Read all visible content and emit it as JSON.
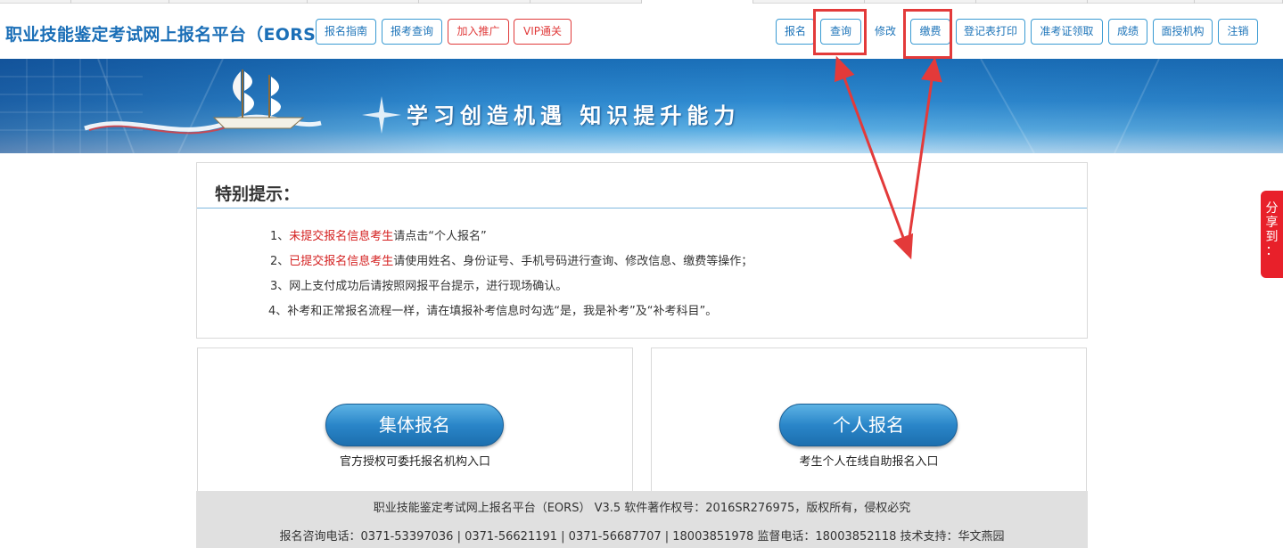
{
  "header": {
    "site_title": "职业技能鉴定考试网上报名平台（EORS）",
    "left_buttons": [
      {
        "label": "报名指南",
        "style": "blue"
      },
      {
        "label": "报考查询",
        "style": "blue"
      },
      {
        "label": "加入推广",
        "style": "red"
      },
      {
        "label": "VIP通关",
        "style": "red"
      }
    ],
    "right_buttons": [
      {
        "label": "报名"
      },
      {
        "label": "查询"
      },
      {
        "label": "修改"
      },
      {
        "label": "缴费"
      },
      {
        "label": "登记表打印"
      },
      {
        "label": "准考证领取"
      },
      {
        "label": "成绩"
      },
      {
        "label": "面授机构"
      },
      {
        "label": "注销"
      }
    ]
  },
  "banner": {
    "slogan": "学习创造机遇  知识提升能力"
  },
  "notice": {
    "title": "特别提示：",
    "items": [
      {
        "num": "1、",
        "highlight": "未提交报名信息考生",
        "text": "请点击“个人报名”"
      },
      {
        "num": "2、",
        "highlight": "已提交报名信息考生",
        "text": "请使用姓名、身份证号、手机号码进行查询、修改信息、缴费等操作；"
      },
      {
        "num": "3、",
        "highlight": "",
        "text": "网上支付成功后请按照网报平台提示，进行现场确认。"
      },
      {
        "num": "4、",
        "highlight": "",
        "text": "补考和正常报名流程一样，请在填报补考信息时勾选“是，我是补考”及“补考科目”。"
      }
    ]
  },
  "panels": {
    "group": {
      "button": "集体报名",
      "caption": "官方授权可委托报名机构入口"
    },
    "individual": {
      "button": "个人报名",
      "caption": "考生个人在线自助报名入口"
    }
  },
  "footer": {
    "line1": "职业技能鉴定考试网上报名平台（EORS） V3.5 软件著作权号：2016SR276975，版权所有，侵权必究",
    "line2": "报名咨询电话：0371-53397036 | 0371-56621191 | 0371-56687707 |  18003851978  监督电话：18003852118  技术支持：华文燕园"
  },
  "share": {
    "chars": [
      "分",
      "享",
      "到",
      "："
    ]
  },
  "colors": {
    "brand_blue": "#1b6fb7",
    "button_border": "#3a9bd3",
    "red": "#e03a3a",
    "annotation_red": "#e33a3a"
  }
}
